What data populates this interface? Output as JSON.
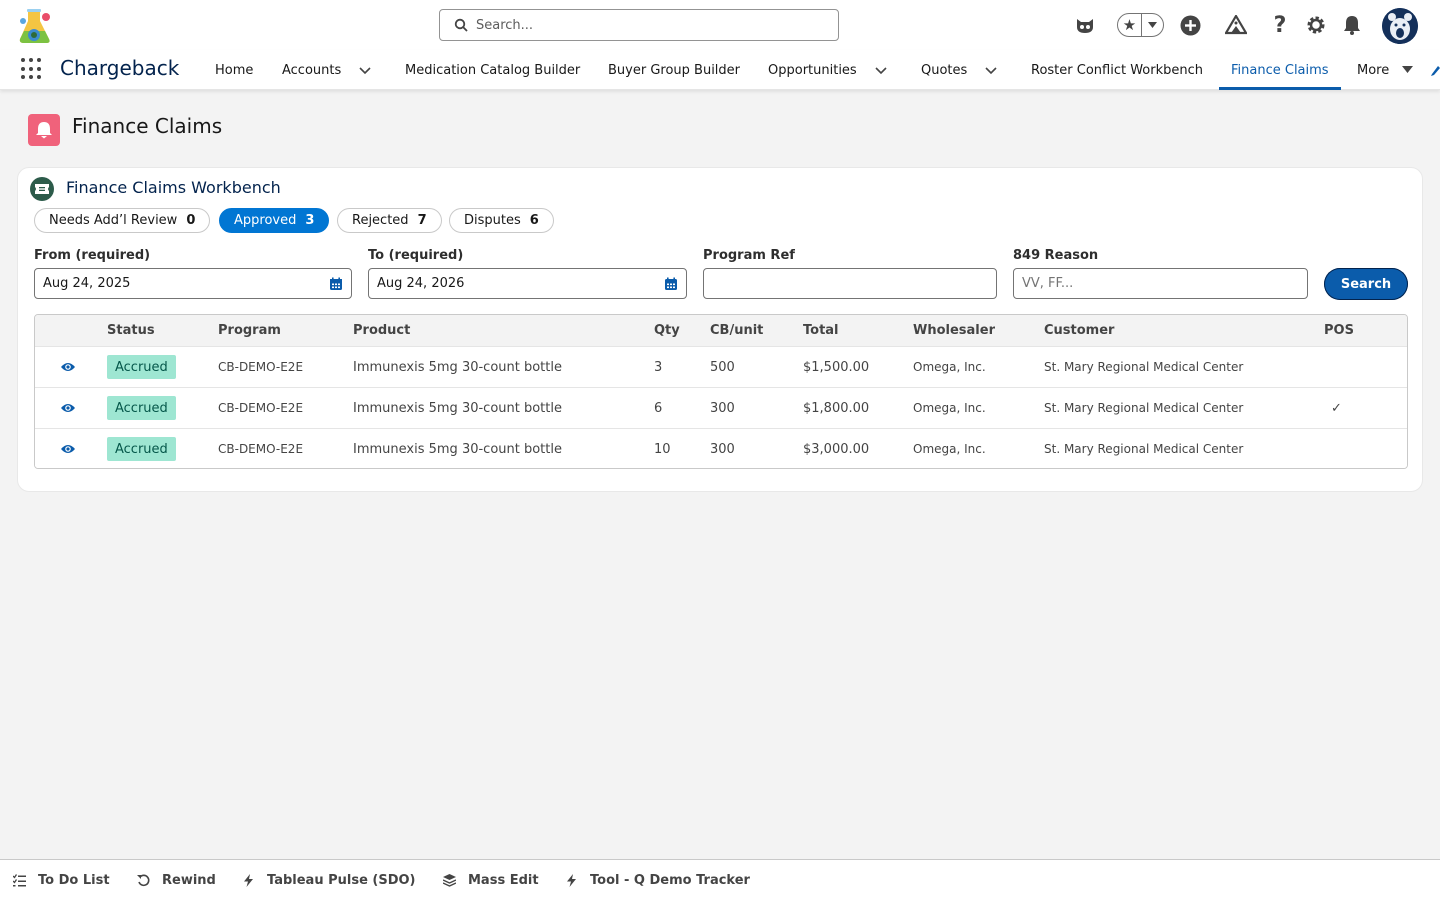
{
  "header": {
    "search_placeholder": "Search..."
  },
  "nav": {
    "app_name": "Chargeback",
    "items": [
      {
        "label": "Home"
      },
      {
        "label": "Accounts"
      },
      {
        "label": "Medication Catalog Builder"
      },
      {
        "label": "Buyer Group Builder"
      },
      {
        "label": "Opportunities"
      },
      {
        "label": "Quotes"
      },
      {
        "label": "Roster Conflict Workbench"
      },
      {
        "label": "Finance Claims"
      },
      {
        "label": "More"
      }
    ],
    "active_item": "Finance Claims"
  },
  "page": {
    "title": "Finance Claims"
  },
  "card": {
    "title": "Finance Claims Workbench",
    "tabs": [
      {
        "label": "Needs Add’l Review",
        "count": "0"
      },
      {
        "label": "Approved",
        "count": "3"
      },
      {
        "label": "Rejected",
        "count": "7"
      },
      {
        "label": "Disputes",
        "count": "6"
      }
    ],
    "active_tab": "Approved",
    "filters": {
      "from_label": "From (required)",
      "from_value": "Aug 24, 2025",
      "to_label": "To (required)",
      "to_value": "Aug 24, 2026",
      "program_ref_label": "Program Ref",
      "program_ref_value": "",
      "reason_label": "849 Reason",
      "reason_placeholder": "VV, FF...",
      "search_label": "Search"
    },
    "table": {
      "columns": [
        "Status",
        "Program",
        "Product",
        "Qty",
        "CB/unit",
        "Total",
        "Wholesaler",
        "Customer",
        "POS"
      ],
      "rows": [
        {
          "status": "Accrued",
          "program": "CB-DEMO-E2E",
          "product": "Immunexis 5mg 30-count bottle",
          "qty": "3",
          "cb_unit": "500",
          "total": "$1,500.00",
          "wholesaler": "Omega, Inc.",
          "customer": "St. Mary Regional Medical Center",
          "pos": ""
        },
        {
          "status": "Accrued",
          "program": "CB-DEMO-E2E",
          "product": "Immunexis 5mg 30-count bottle",
          "qty": "6",
          "cb_unit": "300",
          "total": "$1,800.00",
          "wholesaler": "Omega, Inc.",
          "customer": "St. Mary Regional Medical Center",
          "pos": "✓"
        },
        {
          "status": "Accrued",
          "program": "CB-DEMO-E2E",
          "product": "Immunexis 5mg 30-count bottle",
          "qty": "10",
          "cb_unit": "300",
          "total": "$3,000.00",
          "wholesaler": "Omega, Inc.",
          "customer": "St. Mary Regional Medical Center",
          "pos": ""
        }
      ]
    }
  },
  "utility_bar": {
    "items": [
      {
        "label": "To Do List",
        "icon": "checklist-icon"
      },
      {
        "label": "Rewind",
        "icon": "rewind-icon"
      },
      {
        "label": "Tableau Pulse (SDO)",
        "icon": "bolt-icon"
      },
      {
        "label": "Mass Edit",
        "icon": "layers-icon"
      },
      {
        "label": "Tool - Q Demo Tracker",
        "icon": "bolt-icon"
      }
    ]
  },
  "colors": {
    "brand_blue": "#0b5cab",
    "active_pill": "#0176d3",
    "badge_bg": "#9ee6d2",
    "page_icon": "#f0627b"
  }
}
